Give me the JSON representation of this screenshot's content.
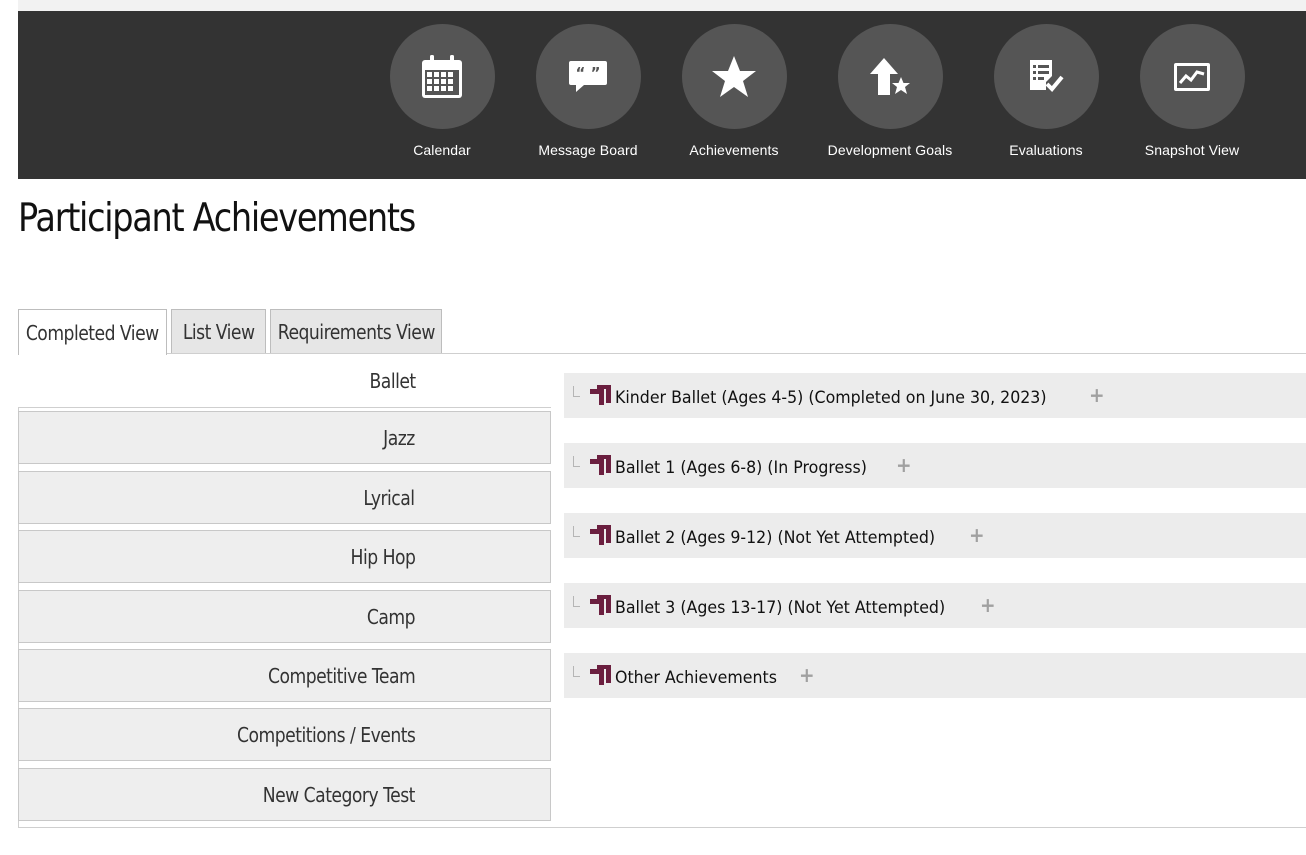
{
  "nav": {
    "items": [
      {
        "label": "Calendar",
        "icon": "calendar-icon"
      },
      {
        "label": "Message Board",
        "icon": "message-board-icon"
      },
      {
        "label": "Achievements",
        "icon": "star-icon"
      },
      {
        "label": "Development Goals",
        "icon": "arrow-up-star-icon"
      },
      {
        "label": "Evaluations",
        "icon": "checklist-icon"
      },
      {
        "label": "Snapshot View",
        "icon": "chart-icon"
      }
    ]
  },
  "page": {
    "title": "Participant Achievements"
  },
  "tabs": [
    {
      "label": "Completed View",
      "active": true
    },
    {
      "label": "List View",
      "active": false
    },
    {
      "label": "Requirements View",
      "active": false
    }
  ],
  "categories": [
    {
      "label": "Ballet",
      "selected": true
    },
    {
      "label": "Jazz",
      "selected": false
    },
    {
      "label": "Lyrical",
      "selected": false
    },
    {
      "label": "Hip Hop",
      "selected": false
    },
    {
      "label": "Camp",
      "selected": false
    },
    {
      "label": "Competitive Team",
      "selected": false
    },
    {
      "label": "Competitions / Events",
      "selected": false
    },
    {
      "label": "New Category Test",
      "selected": false
    }
  ],
  "achievements": [
    {
      "label": "Kinder Ballet (Ages 4-5) (Completed on June 30, 2023)",
      "expand_icon": "+"
    },
    {
      "label": "Ballet 1 (Ages 6-8) (In Progress)",
      "expand_icon": "+"
    },
    {
      "label": "Ballet 2 (Ages 9-12) (Not Yet Attempted)",
      "expand_icon": "+"
    },
    {
      "label": "Ballet 3 (Ages 13-17) (Not Yet Attempted)",
      "expand_icon": "+"
    },
    {
      "label": "Other Achievements",
      "expand_icon": "+"
    }
  ],
  "colors": {
    "navbar": "#333333",
    "nav_circle": "#555555",
    "achievement_icon": "#6b1f3f",
    "panel_bg": "#ececec"
  }
}
